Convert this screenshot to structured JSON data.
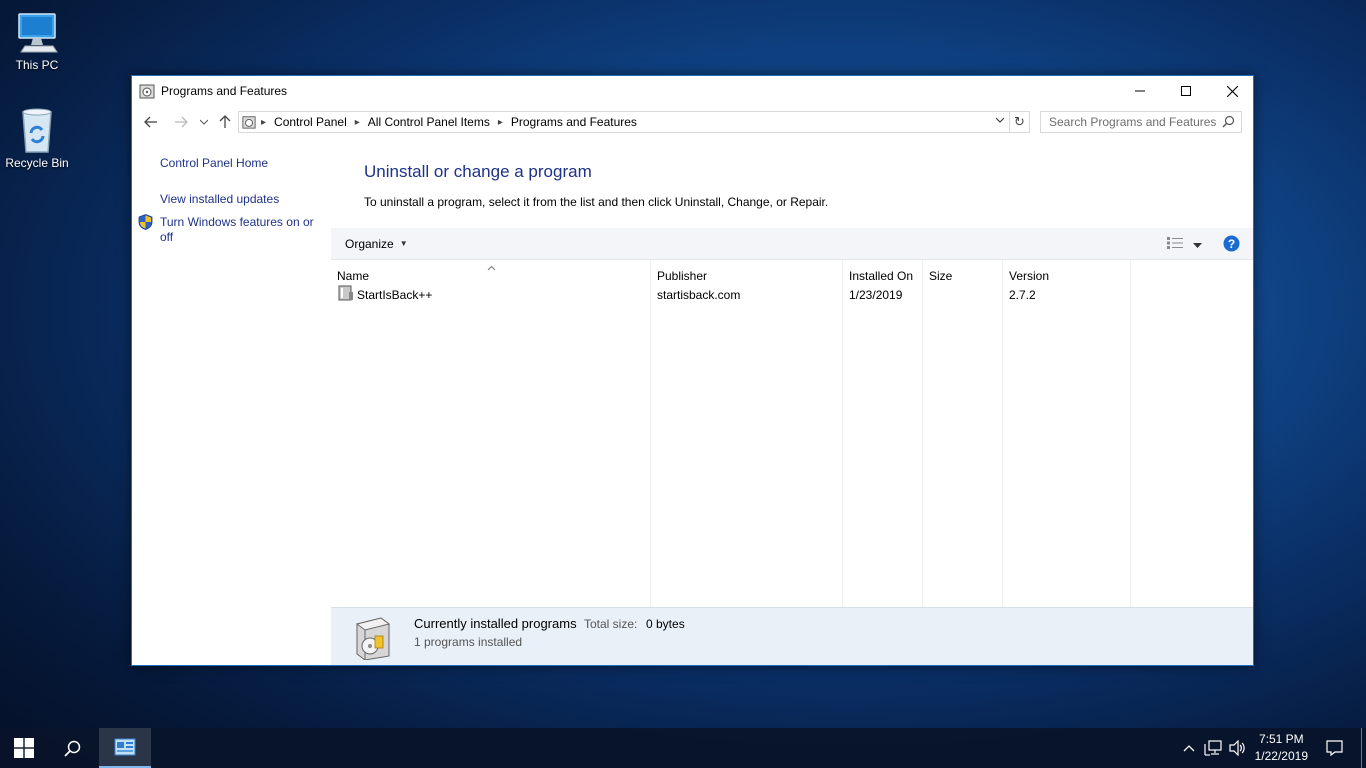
{
  "desktop": {
    "icons": [
      {
        "label": "This PC"
      },
      {
        "label": "Recycle Bin"
      }
    ]
  },
  "window": {
    "title": "Programs and Features",
    "address": {
      "crumbs": [
        "Control Panel",
        "All Control Panel Items",
        "Programs and Features"
      ]
    },
    "search": {
      "placeholder": "Search Programs and Features"
    },
    "sidebar": {
      "home": "Control Panel Home",
      "updates": "View installed updates",
      "features": "Turn Windows features on or off"
    },
    "main": {
      "heading": "Uninstall or change a program",
      "subtext": "To uninstall a program, select it from the list and then click Uninstall, Change, or Repair."
    },
    "toolbar": {
      "organize": "Organize"
    },
    "columns": [
      "Name",
      "Publisher",
      "Installed On",
      "Size",
      "Version"
    ],
    "rows": [
      {
        "name": "StartIsBack++",
        "publisher": "startisback.com",
        "installed_on": "1/23/2019",
        "size": "",
        "version": "2.7.2"
      }
    ],
    "details": {
      "title": "Currently installed programs",
      "total_label": "Total size:",
      "total_value": "0 bytes",
      "count": "1 programs installed"
    }
  },
  "taskbar": {
    "time": "7:51 PM",
    "date": "1/22/2019"
  },
  "colors": {
    "link": "#1e3287",
    "window_border": "#1f6fbf",
    "taskbar": "#08142a",
    "details_bg": "#eaf0f8"
  }
}
